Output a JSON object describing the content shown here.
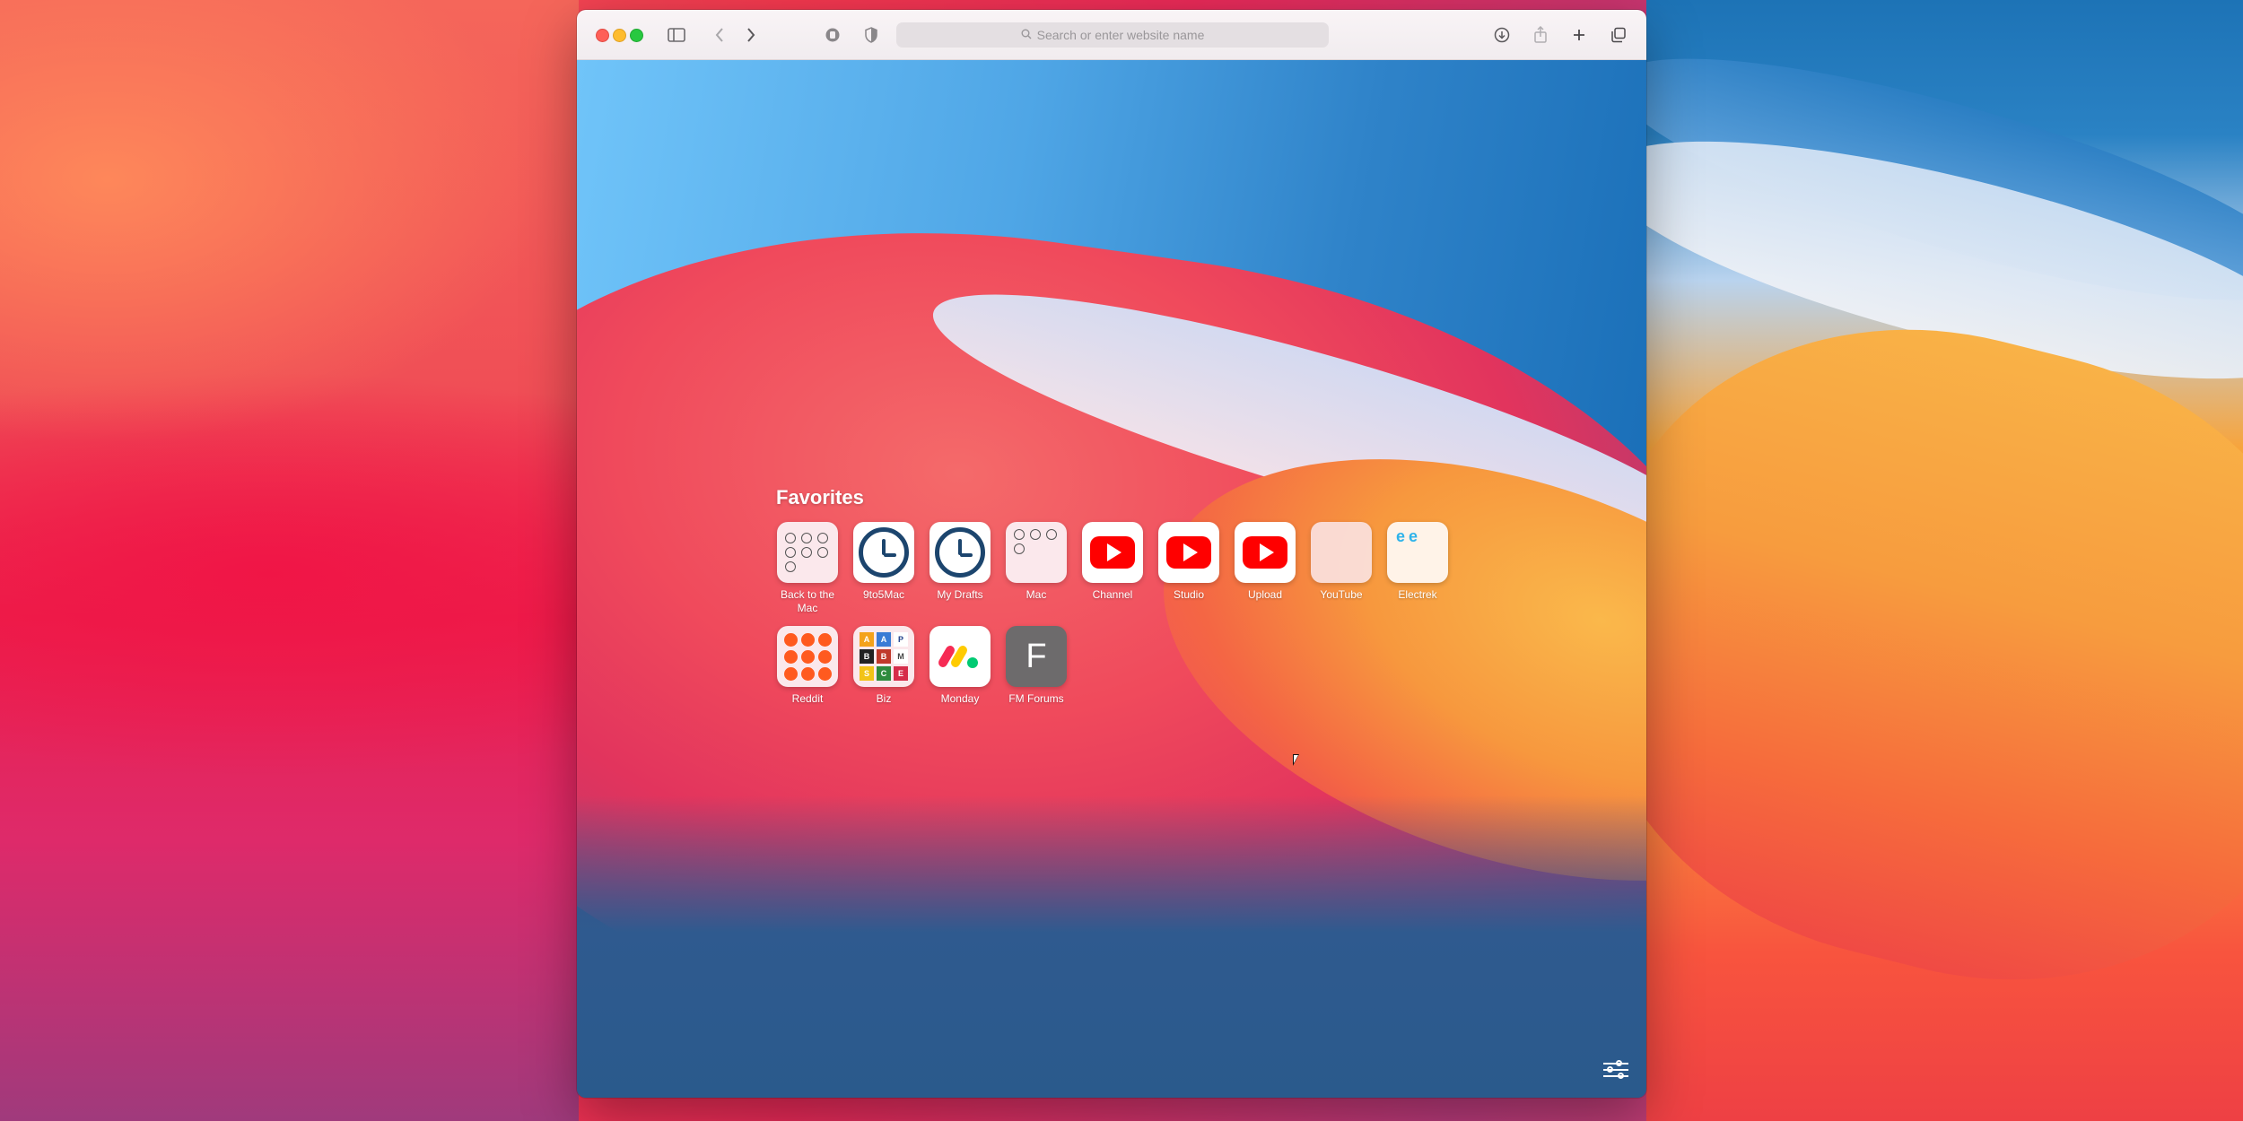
{
  "browser": {
    "address_placeholder": "Search or enter website name",
    "icons": {
      "sidebar": "sidebar-icon",
      "back": "chevron-left-icon",
      "forward": "chevron-right-icon",
      "privacy": "shield-icon",
      "download": "download-icon",
      "share": "share-icon",
      "new_tab": "plus-icon",
      "tabs": "tab-overview-icon"
    }
  },
  "start_page": {
    "favorites_title": "Favorites",
    "favorites": [
      {
        "label": "Back to the Mac",
        "icon": "clock-grid-icon"
      },
      {
        "label": "9to5Mac",
        "icon": "clock-icon"
      },
      {
        "label": "My Drafts",
        "icon": "clock-icon"
      },
      {
        "label": "Mac",
        "icon": "clock-grid-icon"
      },
      {
        "label": "Channel",
        "icon": "youtube-icon"
      },
      {
        "label": "Studio",
        "icon": "youtube-icon"
      },
      {
        "label": "Upload",
        "icon": "youtube-icon"
      },
      {
        "label": "YouTube",
        "icon": "blank-page-icon"
      },
      {
        "label": "Electrek",
        "icon": "electrek-icon"
      },
      {
        "label": "Reddit",
        "icon": "reddit-grid-icon"
      },
      {
        "label": "Biz",
        "icon": "biz-grid-icon"
      },
      {
        "label": "Monday",
        "icon": "monday-icon"
      },
      {
        "label": "FM Forums",
        "icon": "letter-f-icon",
        "letter": "F"
      }
    ],
    "biz_cells": [
      "A",
      "A",
      "P",
      "B",
      "B",
      "M",
      "S",
      "C",
      "E"
    ]
  },
  "colors": {
    "youtube_red": "#ff0000",
    "clock_navy": "#1c456e",
    "reddit_orange": "#ff5a1f"
  }
}
